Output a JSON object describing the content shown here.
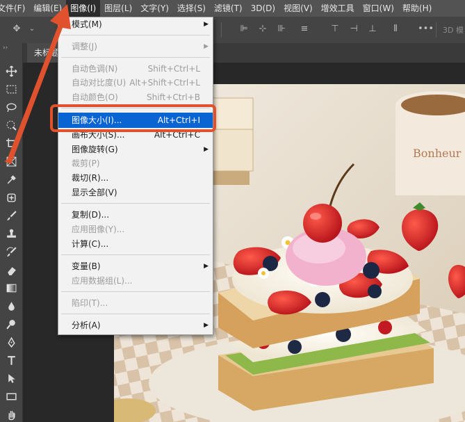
{
  "menubar": {
    "items": [
      "文件(F)",
      "编辑(E)",
      "图像(I)",
      "图层(L)",
      "文字(Y)",
      "选择(S)",
      "滤镜(T)",
      "3D(D)",
      "视图(V)",
      "增效工具",
      "窗口(W)",
      "帮助(H)"
    ]
  },
  "optionsbar": {
    "label_3d": "3D 模"
  },
  "document": {
    "tab_label": "未标题"
  },
  "image_menu": {
    "items": [
      {
        "label": "模式(M)",
        "shortcut": "",
        "submenu": true,
        "disabled": false
      },
      {
        "label": "调整(J)",
        "shortcut": "",
        "submenu": true,
        "disabled": true
      },
      {
        "label": "自动色调(N)",
        "shortcut": "Shift+Ctrl+L",
        "submenu": false,
        "disabled": true
      },
      {
        "label": "自动对比度(U)",
        "shortcut": "Alt+Shift+Ctrl+L",
        "submenu": false,
        "disabled": true
      },
      {
        "label": "自动颜色(O)",
        "shortcut": "Shift+Ctrl+B",
        "submenu": false,
        "disabled": true
      },
      {
        "label": "图像大小(I)...",
        "shortcut": "Alt+Ctrl+I",
        "submenu": false,
        "disabled": false,
        "highlighted": true
      },
      {
        "label": "画布大小(S)...",
        "shortcut": "Alt+Ctrl+C",
        "submenu": false,
        "disabled": false
      },
      {
        "label": "图像旋转(G)",
        "shortcut": "",
        "submenu": true,
        "disabled": false
      },
      {
        "label": "裁剪(P)",
        "shortcut": "",
        "submenu": false,
        "disabled": true
      },
      {
        "label": "裁切(R)...",
        "shortcut": "",
        "submenu": false,
        "disabled": false
      },
      {
        "label": "显示全部(V)",
        "shortcut": "",
        "submenu": false,
        "disabled": false
      },
      {
        "label": "复制(D)...",
        "shortcut": "",
        "submenu": false,
        "disabled": false
      },
      {
        "label": "应用图像(Y)...",
        "shortcut": "",
        "submenu": false,
        "disabled": true
      },
      {
        "label": "计算(C)...",
        "shortcut": "",
        "submenu": false,
        "disabled": false
      },
      {
        "label": "变量(B)",
        "shortcut": "",
        "submenu": true,
        "disabled": false
      },
      {
        "label": "应用数据组(L)...",
        "shortcut": "",
        "submenu": false,
        "disabled": true
      },
      {
        "label": "陷印(T)...",
        "shortcut": "",
        "submenu": false,
        "disabled": true
      },
      {
        "label": "分析(A)",
        "shortcut": "",
        "submenu": true,
        "disabled": false
      }
    ]
  },
  "photo": {
    "cup_text": "Bonheur"
  },
  "colors": {
    "highlight": "#0a64d2",
    "annotation": "#e0522e",
    "menubar": "#535353",
    "panel": "#444444"
  }
}
